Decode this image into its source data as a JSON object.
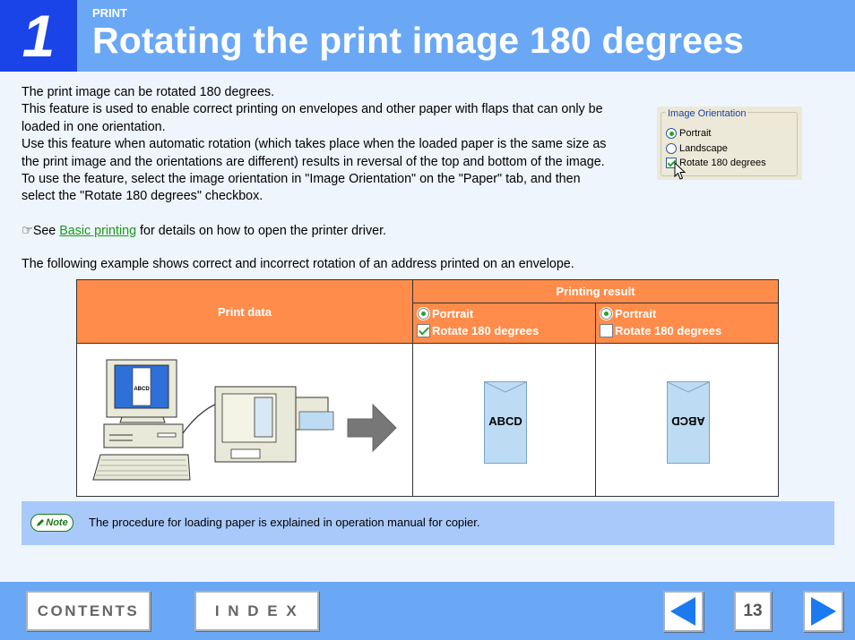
{
  "header": {
    "chapter_number": "1",
    "section_label": "PRINT",
    "title": "Rotating the print image 180 degrees"
  },
  "body": {
    "paragraphs": [
      "The print image can be rotated 180 degrees.",
      "This feature is used to enable correct printing on envelopes and other paper with flaps that can only be loaded in one orientation.",
      "Use this feature when automatic rotation (which takes place when the loaded paper is the same size as the print image and the orientations are different) results in reversal of the top and bottom of the image.",
      "To use the feature, select the image orientation in \"Image Orientation\" on the \"Paper\" tab, and then select the \"Rotate 180 degrees\" checkbox."
    ],
    "see_prefix": "☞See ",
    "see_link": "Basic printing",
    "see_suffix": " for details on how to open the printer driver.",
    "example_intro": "The following example shows correct and incorrect rotation of an address printed on an envelope."
  },
  "dialog": {
    "legend": "Image Orientation",
    "portrait": "Portrait",
    "landscape": "Landscape",
    "rotate": "Rotate 180 degrees"
  },
  "table": {
    "print_data_header": "Print data",
    "printing_result_header": "Printing result",
    "col1": {
      "orientation": "Portrait",
      "rotate": "Rotate 180 degrees",
      "rotate_checked": true
    },
    "col2": {
      "orientation": "Portrait",
      "rotate": "Rotate 180 degrees",
      "rotate_checked": false
    },
    "screen_text": "ABCD",
    "envelope_text": "ABCD"
  },
  "note": {
    "badge": "Note",
    "text": "The procedure for loading paper is explained in operation manual for copier."
  },
  "footer": {
    "contents_label": "CONTENTS",
    "index_label": "I N D E X",
    "page_number": "13"
  },
  "colors": {
    "header_blue": "#6aa8f5",
    "chapter_blue": "#1a44e8",
    "table_orange": "#ff8c4a",
    "note_blue": "#a9c9fb",
    "link_green": "#1a9a1a"
  },
  "icons": [
    "pencil-icon",
    "arrow-left-icon",
    "arrow-right-icon",
    "mouse-cursor-icon"
  ]
}
